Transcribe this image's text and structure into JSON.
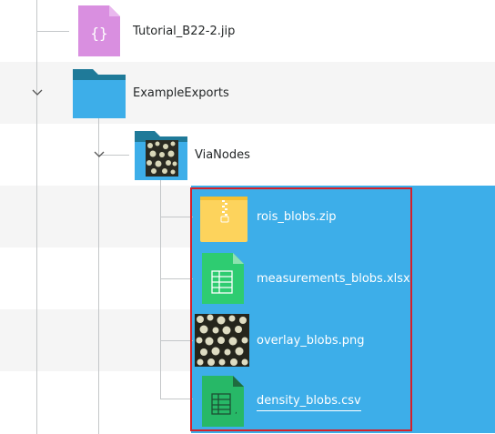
{
  "files": {
    "tutorial": {
      "name": "Tutorial_B22-2.jip",
      "icon": "json-file-icon"
    },
    "example_exports": {
      "name": "ExampleExports",
      "icon": "folder-icon"
    },
    "via_nodes": {
      "name": "ViaNodes",
      "icon": "image-folder-icon"
    },
    "rois": {
      "name": "rois_blobs.zip",
      "icon": "zip-archive-icon"
    },
    "measurements": {
      "name": "measurements_blobs.xlsx",
      "icon": "spreadsheet-icon"
    },
    "overlay": {
      "name": "overlay_blobs.png",
      "icon": "image-thumbnail-icon"
    },
    "density": {
      "name": "density_blobs.csv",
      "icon": "csv-file-icon"
    }
  },
  "colors": {
    "selection": "#3daee9",
    "highlight_border": "#d4202a",
    "folder": "#3daee9",
    "folder_tab": "#1f7a99",
    "zip": "#fdd35c",
    "spreadsheet": "#2ecc71",
    "json": "#d98fe0"
  }
}
